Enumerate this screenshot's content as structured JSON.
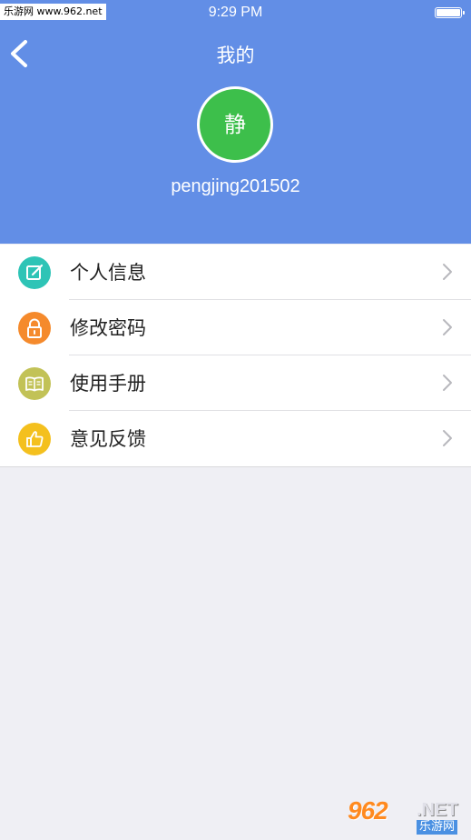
{
  "status_bar": {
    "watermark": "乐游网 www.962.net",
    "time": "9:29 PM"
  },
  "nav": {
    "title": "我的",
    "back_icon": "chevron-left-icon"
  },
  "profile": {
    "avatar_text": "静",
    "avatar_color": "#3dbf4b",
    "username": "pengjing201502"
  },
  "menu": {
    "items": [
      {
        "label": "个人信息",
        "icon": "edit-icon",
        "color": "#2ec4b6"
      },
      {
        "label": "修改密码",
        "icon": "lock-icon",
        "color": "#f58a2c"
      },
      {
        "label": "使用手册",
        "icon": "book-icon",
        "color": "#c2c257"
      },
      {
        "label": "意见反馈",
        "icon": "thumbs-up-icon",
        "color": "#f4c01e"
      }
    ]
  },
  "watermark_bottom": {
    "number": "962",
    "suffix": ".NET",
    "site_name": "乐游网"
  },
  "colors": {
    "header": "#628ee6",
    "background": "#efeff4"
  }
}
